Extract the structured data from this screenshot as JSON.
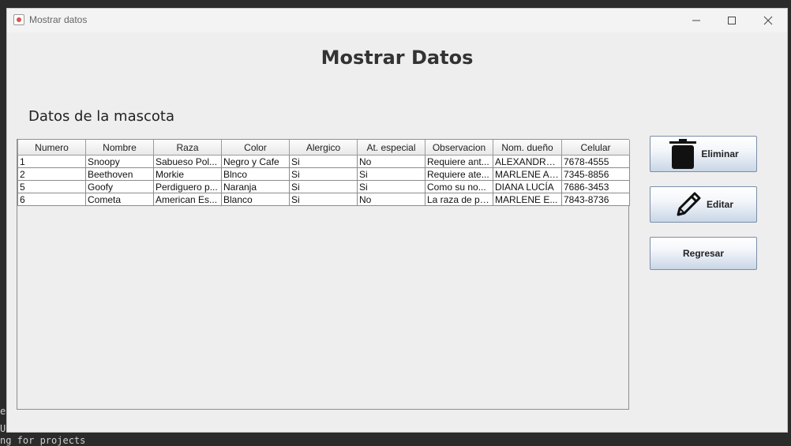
{
  "window": {
    "title": "Mostrar datos",
    "controls": [
      "minimize",
      "maximize",
      "close"
    ]
  },
  "heading": "Mostrar Datos",
  "section": "Datos de la mascota",
  "table": {
    "columns": [
      "Numero",
      "Nombre",
      "Raza",
      "Color",
      "Alergico",
      "At. especial",
      "Observacion",
      "Nom. dueño",
      "Celular"
    ],
    "rows": [
      [
        "1",
        "Snoopy",
        "Sabueso Pol...",
        "Negro y Cafe",
        "Si",
        "No",
        "Requiere ant...",
        "ALEXANDRA ...",
        "7678-4555"
      ],
      [
        "2",
        "Beethoven",
        "Morkie",
        "Blnco",
        "Si",
        "Si",
        "Requiere ate...",
        "MARLENE AL...",
        "7345-8856"
      ],
      [
        "5",
        "Goofy",
        "Perdiguero p...",
        "Naranja",
        "Si",
        "Si",
        "Como su no...",
        "DIANA LUCÍA",
        "7686-3453"
      ],
      [
        "6",
        "Cometa",
        "American Es...",
        "Blanco",
        "Si",
        "No",
        "La raza de pe...",
        "MARLENE E...",
        "7843-8736"
      ]
    ]
  },
  "buttons": {
    "delete": {
      "label": "Eliminar",
      "icon": "trash-icon"
    },
    "edit": {
      "label": "Editar",
      "icon": "pencil-icon"
    },
    "back": {
      "label": "Regresar"
    }
  },
  "background": {
    "line1": "el",
    "line2": "U",
    "line3": "ng for projects"
  }
}
